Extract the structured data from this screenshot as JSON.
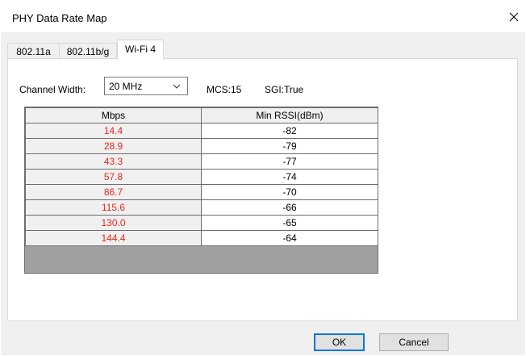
{
  "window": {
    "title": "PHY Data Rate Map"
  },
  "tabs": [
    {
      "label": "802.11a"
    },
    {
      "label": "802.11b/g"
    },
    {
      "label": "Wi-Fi 4"
    }
  ],
  "active_tab": "Wi-Fi 4",
  "controls": {
    "channel_width_label": "Channel Width:",
    "channel_width_value": "20 MHz",
    "mcs_text": "MCS:15",
    "sgi_text": "SGI:True"
  },
  "table": {
    "headers": [
      "Mbps",
      "Min RSSI(dBm)"
    ],
    "rows": [
      {
        "mbps": "14.4",
        "rssi": "-82"
      },
      {
        "mbps": "28.9",
        "rssi": "-79"
      },
      {
        "mbps": "43.3",
        "rssi": "-77"
      },
      {
        "mbps": "57.8",
        "rssi": "-74"
      },
      {
        "mbps": "86.7",
        "rssi": "-70"
      },
      {
        "mbps": "115.6",
        "rssi": "-66"
      },
      {
        "mbps": "130.0",
        "rssi": "-65"
      },
      {
        "mbps": "144.4",
        "rssi": "-64"
      }
    ]
  },
  "buttons": {
    "ok": "OK",
    "cancel": "Cancel"
  },
  "colors": {
    "mbps_text": "#e8261c",
    "default_button_border": "#0078d7",
    "grid_background": "#a0a0a0"
  },
  "icons": {
    "close": "close-icon",
    "dropdown": "chevron-down-icon"
  }
}
